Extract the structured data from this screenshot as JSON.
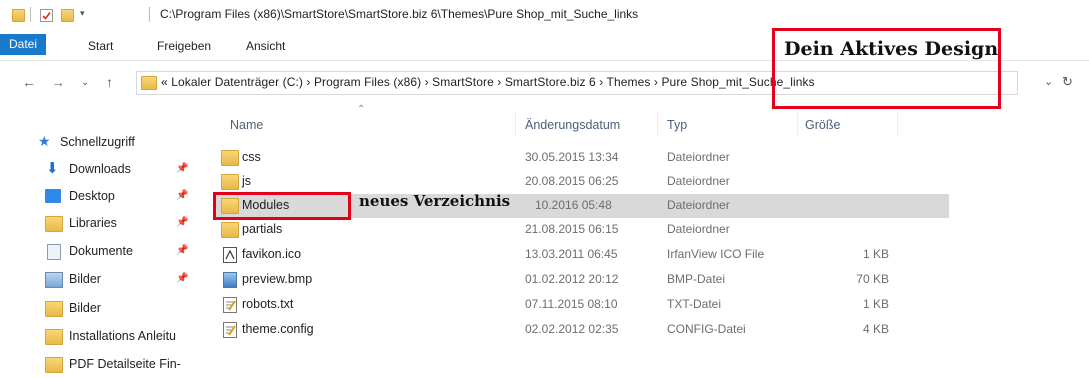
{
  "window": {
    "title": "C:\\Program Files (x86)\\SmartStore\\SmartStore.biz 6\\Themes\\Pure Shop_mit_Suche_links"
  },
  "ribbon": {
    "tabs": [
      "Datei",
      "Start",
      "Freigeben",
      "Ansicht"
    ],
    "active_color": "#1979ca"
  },
  "address": {
    "path": "« Lokaler Datenträger (C:)  ›  Program Files (x86)  ›  SmartStore  ›  SmartStore.biz 6  ›  Themes  ›  Pure Shop_mit_Suche_links"
  },
  "nav": {
    "quick_access": "Schnellzugriff",
    "items": [
      {
        "label": "Downloads",
        "icon": "download-icon",
        "pinned": true
      },
      {
        "label": "Desktop",
        "icon": "desktop-icon",
        "pinned": true
      },
      {
        "label": "Libraries",
        "icon": "folder-icon",
        "pinned": true
      },
      {
        "label": "Dokumente",
        "icon": "documents-icon",
        "pinned": true
      },
      {
        "label": "Bilder",
        "icon": "pictures-icon",
        "pinned": true
      },
      {
        "label": "Bilder",
        "icon": "folder-icon",
        "pinned": false
      },
      {
        "label": "Installations Anleitu",
        "icon": "folder-icon",
        "pinned": false
      },
      {
        "label": "PDF Detailseite Fin-",
        "icon": "folder-icon",
        "pinned": false
      }
    ]
  },
  "columns": {
    "name": "Name",
    "date": "Änderungsdatum",
    "type": "Typ",
    "size": "Größe"
  },
  "files": [
    {
      "name": "css",
      "date": "30.05.2015 13:34",
      "type": "Dateiordner",
      "size": "",
      "icon": "folder-icon"
    },
    {
      "name": "js",
      "date": "20.08.2015 06:25",
      "type": "Dateiordner",
      "size": "",
      "icon": "folder-icon"
    },
    {
      "name": "Modules",
      "date": "10.2016 05:48",
      "type": "Dateiordner",
      "size": "",
      "icon": "folder-icon",
      "selected": true
    },
    {
      "name": "partials",
      "date": "21.08.2015 06:15",
      "type": "Dateiordner",
      "size": "",
      "icon": "folder-icon"
    },
    {
      "name": "favikon.ico",
      "date": "13.03.2011 06:45",
      "type": "IrfanView ICO File",
      "size": "1 KB",
      "icon": "ico-file-icon"
    },
    {
      "name": "preview.bmp",
      "date": "01.02.2012 20:12",
      "type": "BMP-Datei",
      "size": "70 KB",
      "icon": "image-file-icon"
    },
    {
      "name": "robots.txt",
      "date": "07.11.2015 08:10",
      "type": "TXT-Datei",
      "size": "1 KB",
      "icon": "text-file-icon"
    },
    {
      "name": "theme.config",
      "date": "02.02.2012 02:35",
      "type": "CONFIG-Datei",
      "size": "4 KB",
      "icon": "config-file-icon"
    }
  ],
  "annotations": {
    "active_design": "Dein Aktives Design",
    "new_directory": "neues Verzeichnis",
    "highlight_color": "#e2001a"
  }
}
